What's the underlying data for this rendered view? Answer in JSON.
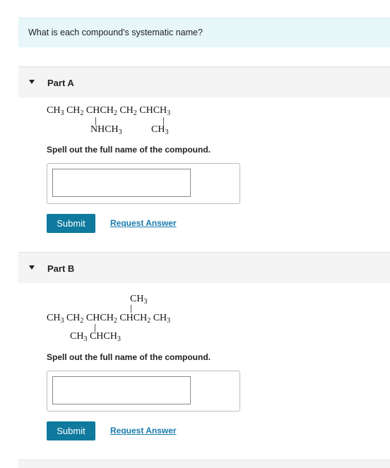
{
  "question": "What is each compound's systematic name?",
  "partA": {
    "title": "Part A",
    "main_chain": [
      "CH",
      "3",
      "CH",
      "2",
      "CHCH",
      "2",
      "CH",
      "2",
      "CHCH",
      "3"
    ],
    "sub1": [
      "NHCH",
      "3"
    ],
    "sub2": [
      "CH",
      "3"
    ],
    "instruction": "Spell out the full name of the compound.",
    "input_value": "",
    "submit_label": "Submit",
    "request_label": "Request Answer"
  },
  "partB": {
    "title": "Part B",
    "top_sub": [
      "CH",
      "3"
    ],
    "main_chain": [
      "CH",
      "3",
      "CH",
      "2",
      "CHCH",
      "2",
      "CHCH",
      "2",
      "CH",
      "3"
    ],
    "bottom_sub": [
      "CH",
      "3",
      "CHCH",
      "3"
    ],
    "instruction": "Spell out the full name of the compound.",
    "input_value": "",
    "submit_label": "Submit",
    "request_label": "Request Answer"
  }
}
